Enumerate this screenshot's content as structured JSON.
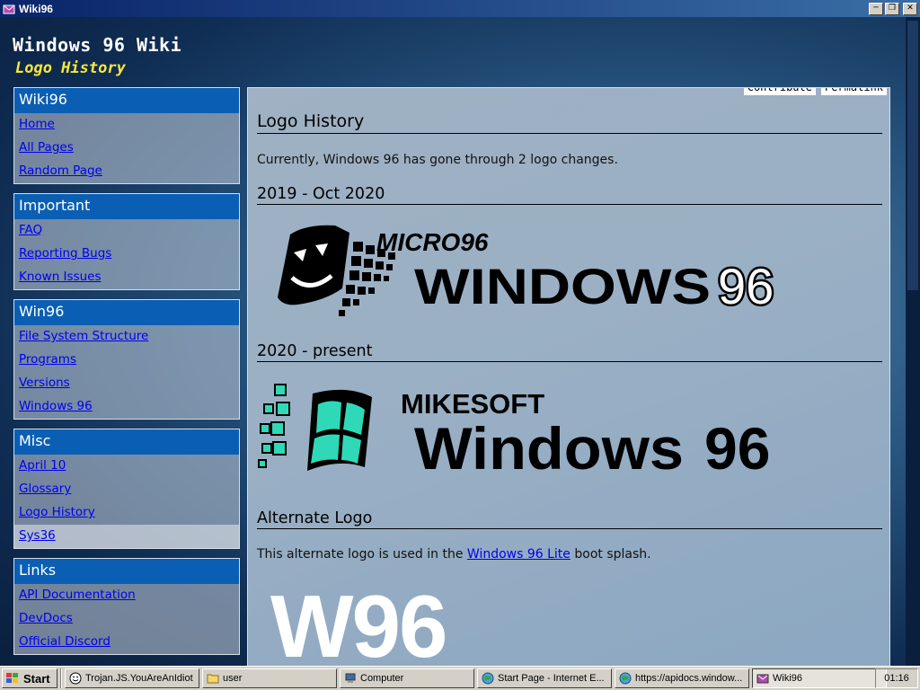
{
  "window": {
    "title": "Wiki96"
  },
  "site": {
    "title": "Windows 96 Wiki",
    "subtitle": "Logo History"
  },
  "sidebar": {
    "boxes": [
      {
        "heading": "Wiki96",
        "links": [
          "Home",
          "All Pages",
          "Random Page"
        ]
      },
      {
        "heading": "Important",
        "links": [
          "FAQ",
          "Reporting Bugs",
          "Known Issues"
        ]
      },
      {
        "heading": "Win96",
        "links": [
          "File System Structure",
          "Programs",
          "Versions",
          "Windows 96"
        ]
      },
      {
        "heading": "Misc",
        "links": [
          "April 10",
          "Glossary",
          "Logo History",
          "Sys36"
        ]
      },
      {
        "heading": "Links",
        "links": [
          "API Documentation",
          "DevDocs",
          "Official Discord"
        ]
      }
    ]
  },
  "page": {
    "tabs": {
      "contribute": "Contribute",
      "permalink": "Permalink"
    },
    "title": "Logo History",
    "intro": "Currently, Windows 96 has gone through 2 logo changes.",
    "sections": [
      {
        "heading": "2019 - Oct 2020",
        "logo_small": "MICRO96",
        "logo_big": "WINDOWS",
        "logo_num": "96"
      },
      {
        "heading": "2020 - present",
        "logo_small": "MIKESOFT",
        "logo_big": "Windows",
        "logo_num": "96"
      },
      {
        "heading": "Alternate Logo"
      }
    ],
    "alt_text_before": "This alternate logo is used in the ",
    "alt_link": "Windows 96 Lite",
    "alt_text_after": " boot splash.",
    "alt_logo": "W96"
  },
  "taskbar": {
    "start": "Start",
    "tasks": [
      "Trojan.JS.YouAreAnIdiot",
      "user",
      "Computer",
      "Start Page - Internet E...",
      "https://apidocs.window...",
      "Wiki96"
    ],
    "clock": "01:16"
  },
  "colors": {
    "accent": "#0a5fb4",
    "subtitle": "#f6e83c",
    "link": "#0000ee",
    "logo_teal": "#2fd9b7"
  }
}
